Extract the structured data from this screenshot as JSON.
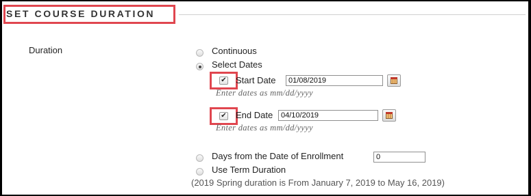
{
  "section": {
    "title": "SET COURSE DURATION"
  },
  "duration": {
    "label": "Duration",
    "options": {
      "continuous": "Continuous",
      "select_dates": "Select Dates",
      "days_from_enrollment": "Days from the Date of Enrollment",
      "use_term": "Use Term Duration"
    },
    "selected": "select_dates",
    "start_date": {
      "checked": true,
      "label": "Start Date",
      "value": "01/08/2019",
      "hint": "Enter dates as mm/dd/yyyy"
    },
    "end_date": {
      "checked": true,
      "label": "End Date",
      "value": "04/10/2019",
      "hint": "Enter dates as mm/dd/yyyy"
    },
    "days_value": "0",
    "term_note": "(2019 Spring duration is From January 7, 2019 to May 16, 2019)"
  },
  "icons": {
    "checkmark": "✔",
    "calendar": "calendar-icon"
  },
  "colors": {
    "highlight": "#e0464f",
    "background": "#ffffff",
    "frame": "#000000"
  }
}
